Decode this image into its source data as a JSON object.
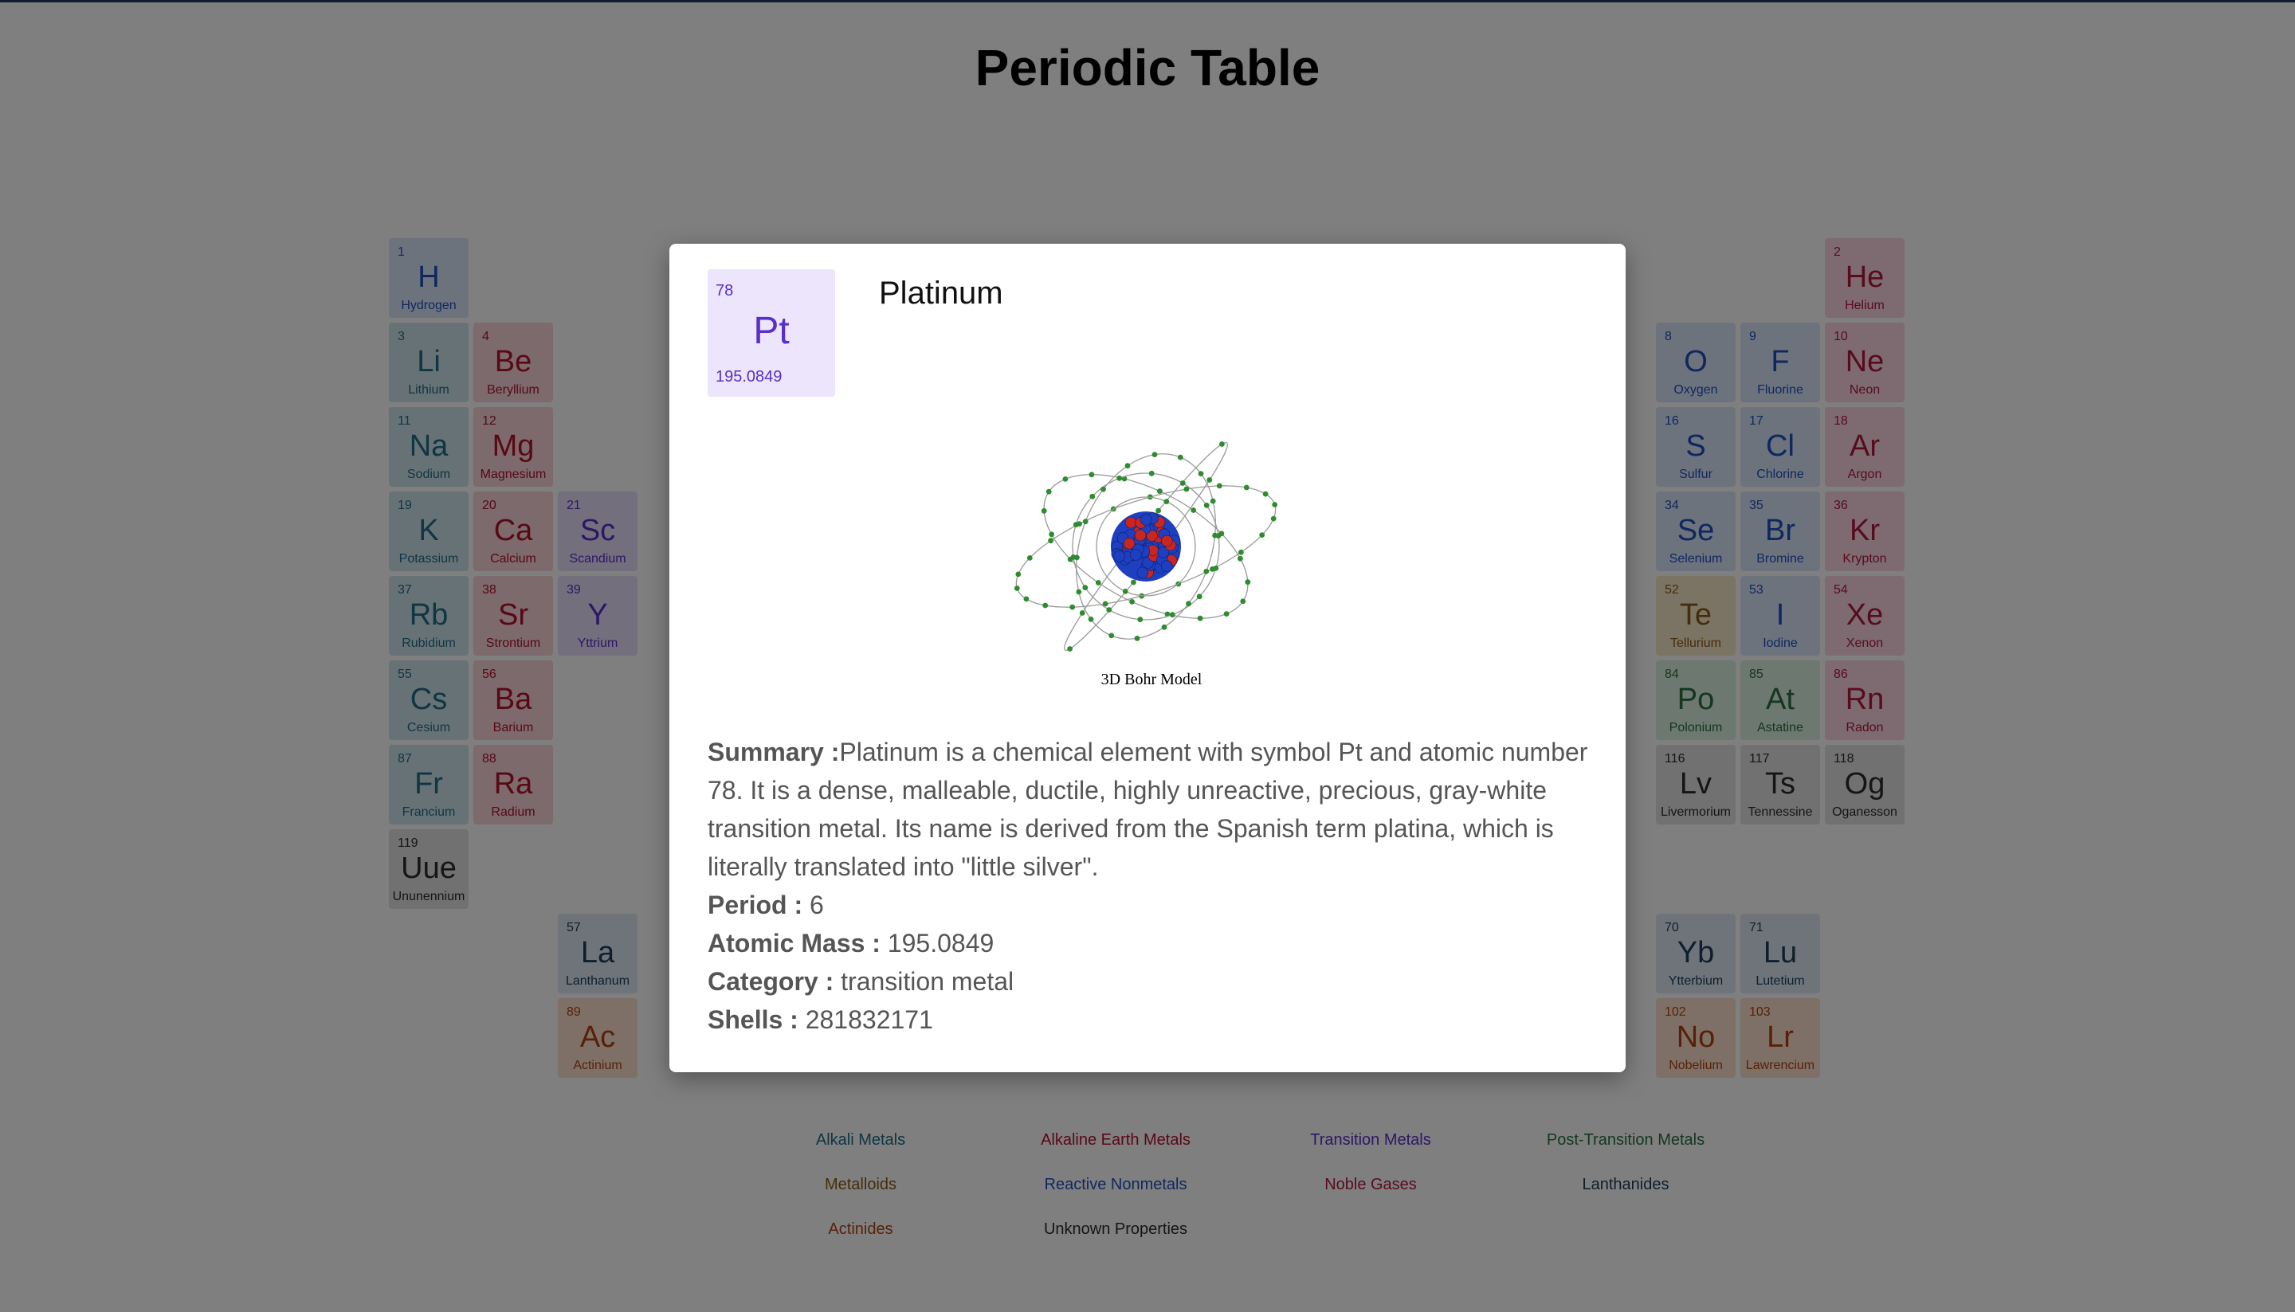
{
  "page": {
    "title": "Periodic Table"
  },
  "table": {
    "cells": [
      {
        "n": "1",
        "s": "H",
        "name": "Hydrogen",
        "c": "nonmetal",
        "col": 0,
        "row": 0
      },
      {
        "n": "2",
        "s": "He",
        "name": "Helium",
        "c": "noble",
        "col": 17,
        "row": 0
      },
      {
        "n": "3",
        "s": "Li",
        "name": "Lithium",
        "c": "alkali",
        "col": 0,
        "row": 1
      },
      {
        "n": "4",
        "s": "Be",
        "name": "Beryllium",
        "c": "alkaline",
        "col": 1,
        "row": 1
      },
      {
        "n": "8",
        "s": "O",
        "name": "Oxygen",
        "c": "nonmetal",
        "col": 15,
        "row": 1
      },
      {
        "n": "9",
        "s": "F",
        "name": "Fluorine",
        "c": "nonmetal",
        "col": 16,
        "row": 1
      },
      {
        "n": "10",
        "s": "Ne",
        "name": "Neon",
        "c": "noble",
        "col": 17,
        "row": 1
      },
      {
        "n": "11",
        "s": "Na",
        "name": "Sodium",
        "c": "alkali",
        "col": 0,
        "row": 2
      },
      {
        "n": "12",
        "s": "Mg",
        "name": "Magnesium",
        "c": "alkaline",
        "col": 1,
        "row": 2
      },
      {
        "n": "16",
        "s": "S",
        "name": "Sulfur",
        "c": "nonmetal",
        "col": 15,
        "row": 2
      },
      {
        "n": "17",
        "s": "Cl",
        "name": "Chlorine",
        "c": "nonmetal",
        "col": 16,
        "row": 2
      },
      {
        "n": "18",
        "s": "Ar",
        "name": "Argon",
        "c": "noble",
        "col": 17,
        "row": 2
      },
      {
        "n": "19",
        "s": "K",
        "name": "Potassium",
        "c": "alkali",
        "col": 0,
        "row": 3
      },
      {
        "n": "20",
        "s": "Ca",
        "name": "Calcium",
        "c": "alkaline",
        "col": 1,
        "row": 3
      },
      {
        "n": "21",
        "s": "Sc",
        "name": "Scandium",
        "c": "transition",
        "col": 2,
        "row": 3
      },
      {
        "n": "34",
        "s": "Se",
        "name": "Selenium",
        "c": "nonmetal",
        "col": 15,
        "row": 3
      },
      {
        "n": "35",
        "s": "Br",
        "name": "Bromine",
        "c": "nonmetal",
        "col": 16,
        "row": 3
      },
      {
        "n": "36",
        "s": "Kr",
        "name": "Krypton",
        "c": "noble",
        "col": 17,
        "row": 3
      },
      {
        "n": "37",
        "s": "Rb",
        "name": "Rubidium",
        "c": "alkali",
        "col": 0,
        "row": 4
      },
      {
        "n": "38",
        "s": "Sr",
        "name": "Strontium",
        "c": "alkaline",
        "col": 1,
        "row": 4
      },
      {
        "n": "39",
        "s": "Y",
        "name": "Yttrium",
        "c": "transition",
        "col": 2,
        "row": 4
      },
      {
        "n": "52",
        "s": "Te",
        "name": "Tellurium",
        "c": "metalloid",
        "col": 15,
        "row": 4
      },
      {
        "n": "53",
        "s": "I",
        "name": "Iodine",
        "c": "nonmetal",
        "col": 16,
        "row": 4
      },
      {
        "n": "54",
        "s": "Xe",
        "name": "Xenon",
        "c": "noble",
        "col": 17,
        "row": 4
      },
      {
        "n": "55",
        "s": "Cs",
        "name": "Cesium",
        "c": "alkali",
        "col": 0,
        "row": 5
      },
      {
        "n": "56",
        "s": "Ba",
        "name": "Barium",
        "c": "alkaline",
        "col": 1,
        "row": 5
      },
      {
        "n": "84",
        "s": "Po",
        "name": "Polonium",
        "c": "post",
        "col": 15,
        "row": 5
      },
      {
        "n": "85",
        "s": "At",
        "name": "Astatine",
        "c": "post",
        "col": 16,
        "row": 5
      },
      {
        "n": "86",
        "s": "Rn",
        "name": "Radon",
        "c": "noble",
        "col": 17,
        "row": 5
      },
      {
        "n": "87",
        "s": "Fr",
        "name": "Francium",
        "c": "alkali",
        "col": 0,
        "row": 6
      },
      {
        "n": "88",
        "s": "Ra",
        "name": "Radium",
        "c": "alkaline",
        "col": 1,
        "row": 6
      },
      {
        "n": "116",
        "s": "Lv",
        "name": "Livermorium",
        "c": "unknown",
        "col": 15,
        "row": 6
      },
      {
        "n": "117",
        "s": "Ts",
        "name": "Tennessine",
        "c": "unknown",
        "col": 16,
        "row": 6
      },
      {
        "n": "118",
        "s": "Og",
        "name": "Oganesson",
        "c": "unknown",
        "col": 17,
        "row": 6
      },
      {
        "n": "119",
        "s": "Uue",
        "name": "Ununennium",
        "c": "unknown",
        "col": 0,
        "row": 7
      },
      {
        "n": "57",
        "s": "La",
        "name": "Lanthanum",
        "c": "lanth",
        "col": 2,
        "row": 8
      },
      {
        "n": "70",
        "s": "Yb",
        "name": "Ytterbium",
        "c": "lanth",
        "col": 15,
        "row": 8
      },
      {
        "n": "71",
        "s": "Lu",
        "name": "Lutetium",
        "c": "lanth",
        "col": 16,
        "row": 8
      },
      {
        "n": "89",
        "s": "Ac",
        "name": "Actinium",
        "c": "actin",
        "col": 2,
        "row": 9
      },
      {
        "n": "102",
        "s": "No",
        "name": "Nobelium",
        "c": "actin",
        "col": 15,
        "row": 9
      },
      {
        "n": "103",
        "s": "Lr",
        "name": "Lawrencium",
        "c": "actin",
        "col": 16,
        "row": 9
      }
    ]
  },
  "legend": {
    "items": [
      {
        "label": "Alkali Metals",
        "color": "#216a86"
      },
      {
        "label": "Alkaline Earth Metals",
        "color": "#b2112b"
      },
      {
        "label": "Transition Metals",
        "color": "#5a2fc8"
      },
      {
        "label": "Post-Transition Metals",
        "color": "#2b6e3f"
      },
      {
        "label": "Metalloids",
        "color": "#8a5a12"
      },
      {
        "label": "Reactive Nonmetals",
        "color": "#1f4fbf"
      },
      {
        "label": "Noble Gases",
        "color": "#b3163d"
      },
      {
        "label": "Lanthanides",
        "color": "#1c3d5a"
      },
      {
        "label": "Actinides",
        "color": "#b0420f"
      },
      {
        "label": "Unknown Properties",
        "color": "#2a2a2a"
      }
    ]
  },
  "modal": {
    "atomic_number": "78",
    "symbol": "Pt",
    "mass": "195.0849",
    "name": "Platinum",
    "image_caption": "3D Bohr Model",
    "summary_label": "Summary :",
    "summary": "Platinum is a chemical element with symbol Pt and atomic number 78. It is a dense, malleable, ductile, highly unreactive, precious, gray-white transition metal. Its name is derived from the Spanish term platina, which is literally translated into \"little silver\".",
    "period_label": "Period :",
    "period": "6",
    "atomic_mass_label": "Atomic Mass :",
    "atomic_mass": "195.0849",
    "category_label": "Category :",
    "category": "transition metal",
    "shells_label": "Shells :",
    "shells": "281832171"
  },
  "colors": {
    "overlay": "rgba(0,0,0,0.5)",
    "tile_transition_bg": "#ece5fb",
    "tile_transition_fg": "#5a2fc8",
    "nucleus_proton": "#c8261f",
    "nucleus_neutron": "#1e3fbf",
    "electron": "#2e8b2e"
  }
}
